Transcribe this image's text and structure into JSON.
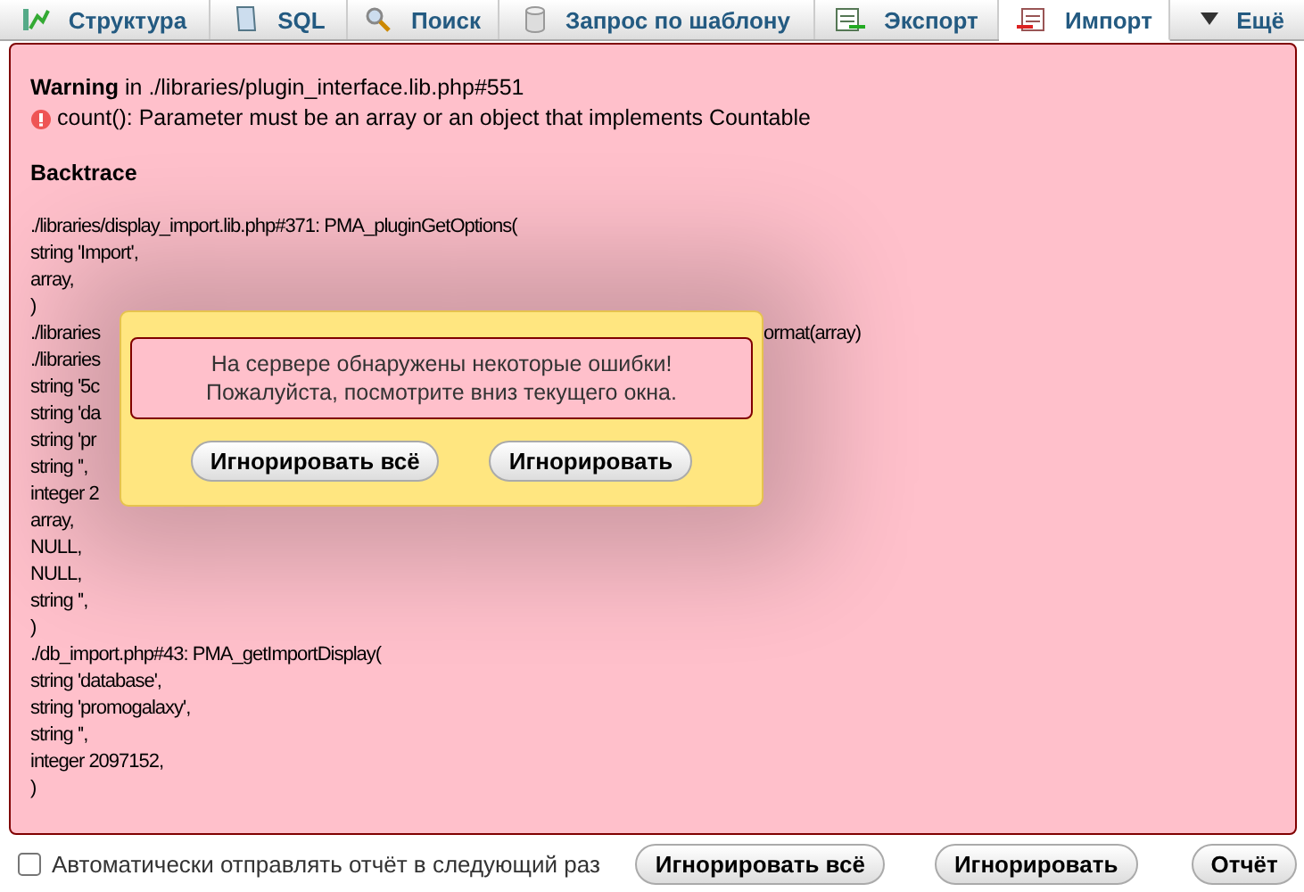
{
  "tabs": [
    {
      "label": "Структура",
      "selected": false
    },
    {
      "label": "SQL",
      "selected": false
    },
    {
      "label": "Поиск",
      "selected": false
    },
    {
      "label": "Запрос по шаблону",
      "selected": false
    },
    {
      "label": "Экспорт",
      "selected": false
    },
    {
      "label": "Импорт",
      "selected": true
    },
    {
      "label": "Ещё",
      "selected": false
    }
  ],
  "error": {
    "title": "**Warning** in ./libraries/plugin_interface.lib.php#551",
    "message": "count(): Parameter must be an array or an object that implements Countable",
    "backtrace_heading": "Backtrace",
    "lines": [
      {
        "text": "./libraries/display_import.lib.php#371: PMA_pluginGetOptions("
      },
      {
        "text": "string 'Import',"
      },
      {
        "text": "array,"
      },
      {
        "text": ")"
      },
      {
        "text": "./libraries",
        "tail": "ormat(array)"
      },
      {
        "text": "./libraries"
      },
      {
        "text": "string '5c"
      },
      {
        "text": "string 'da"
      },
      {
        "text": "string 'pr"
      },
      {
        "text": "string '',"
      },
      {
        "text": "integer 2"
      },
      {
        "text": "array,"
      },
      {
        "text": "NULL,"
      },
      {
        "text": "NULL,"
      },
      {
        "text": "string '',"
      },
      {
        "text": ")"
      },
      {
        "text": "./db_import.php#43: PMA_getImportDisplay("
      },
      {
        "text": "string 'database',"
      },
      {
        "text": "string 'promogalaxy',"
      },
      {
        "text": "string '',"
      },
      {
        "text": "integer 2097152,"
      },
      {
        "text": ")"
      }
    ]
  },
  "dialog": {
    "message_lines": [
      "На сервере обнаружены некоторые ошибки!",
      "Пожалуйста, посмотрите вниз текущего окна."
    ],
    "buttons": [
      "Игнорировать всё",
      "Игнорировать"
    ]
  },
  "footer": {
    "checkbox": {
      "label": "Автоматически отправлять отчёт в следующий раз",
      "checked": false
    },
    "buttons": [
      "Игнорировать всё",
      "Игнорировать",
      "Отчёт"
    ]
  }
}
